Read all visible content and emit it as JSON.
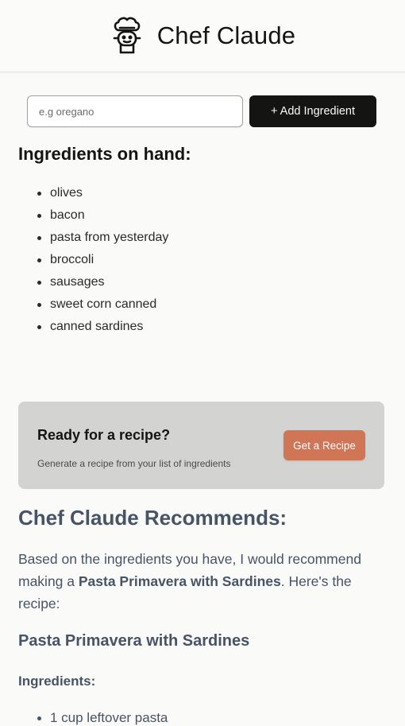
{
  "header": {
    "logo_icon": "chef-hat-icon",
    "title": "Chef Claude"
  },
  "form": {
    "placeholder": "e.g oregano",
    "value": "",
    "add_button_label": "+ Add Ingredient"
  },
  "ingredients": {
    "heading": "Ingredients on hand:",
    "items": [
      "olives",
      "bacon",
      "pasta from yesterday",
      "broccoli",
      "sausages",
      "sweet corn canned",
      "canned sardines"
    ]
  },
  "cta": {
    "title": "Ready for a recipe?",
    "subtitle": "Generate a recipe from your list of ingredients",
    "button_label": "Get a Recipe"
  },
  "recommendation": {
    "heading": "Chef Claude Recommends:",
    "intro_before": "Based on the ingredients you have, I would recommend making a ",
    "intro_bold": "Pasta Primavera with Sardines",
    "intro_after": ". Here's the recipe:",
    "recipe_name": "Pasta Primavera with Sardines",
    "ingredients_heading": "Ingredients:",
    "ingredients": [
      "1 cup leftover pasta"
    ]
  },
  "colors": {
    "background": "#fafaf8",
    "button_dark": "#141413",
    "accent_orange": "#d17557",
    "cta_panel": "#d3d3d1",
    "recipe_text": "#475467"
  }
}
